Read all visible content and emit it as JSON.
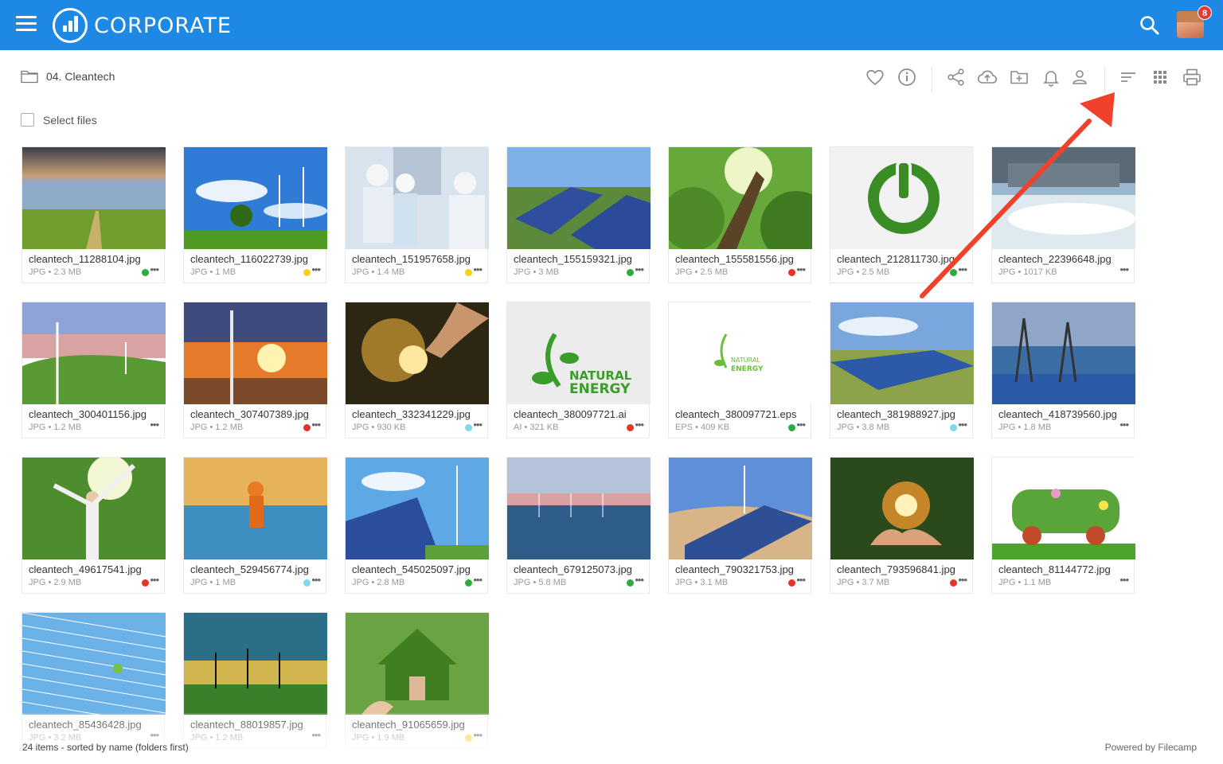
{
  "header": {
    "brand": "CORPORATE",
    "notification_count": "8"
  },
  "breadcrumb": {
    "folder": "04. Cleantech"
  },
  "toolbar": {
    "icons": [
      "heart-icon",
      "info-icon",
      "share-icon",
      "cloud-upload-icon",
      "new-folder-icon",
      "bell-icon",
      "user-icon",
      "sort-icon",
      "grid-view-icon",
      "print-icon"
    ]
  },
  "select_files_label": "Select files",
  "status_colors": {
    "green": "#2eaa3e",
    "yellow": "#f7d11e",
    "red": "#e53527",
    "cyan": "#7fd8ee"
  },
  "files": [
    {
      "name": "cleantech_11288104.jpg",
      "meta": "JPG • 2.3 MB",
      "status": "green"
    },
    {
      "name": "cleantech_116022739.jpg",
      "meta": "JPG • 1 MB",
      "status": "yellow"
    },
    {
      "name": "cleantech_151957658.jpg",
      "meta": "JPG • 1.4 MB",
      "status": "yellow"
    },
    {
      "name": "cleantech_155159321.jpg",
      "meta": "JPG • 3 MB",
      "status": "green"
    },
    {
      "name": "cleantech_155581556.jpg",
      "meta": "JPG • 2.5 MB",
      "status": "red"
    },
    {
      "name": "cleantech_212811730.jpg",
      "meta": "JPG • 2.5 MB",
      "status": "green"
    },
    {
      "name": "cleantech_22396648.jpg",
      "meta": "JPG • 1017 KB",
      "status": ""
    },
    {
      "name": "cleantech_300401156.jpg",
      "meta": "JPG • 1.2 MB",
      "status": ""
    },
    {
      "name": "cleantech_307407389.jpg",
      "meta": "JPG • 1.2 MB",
      "status": "red"
    },
    {
      "name": "cleantech_332341229.jpg",
      "meta": "JPG • 930 KB",
      "status": "cyan"
    },
    {
      "name": "cleantech_380097721.ai",
      "meta": "AI • 321 KB",
      "status": "red"
    },
    {
      "name": "cleantech_380097721.eps",
      "meta": "EPS • 409 KB",
      "status": "green"
    },
    {
      "name": "cleantech_381988927.jpg",
      "meta": "JPG • 3.8 MB",
      "status": "cyan"
    },
    {
      "name": "cleantech_418739560.jpg",
      "meta": "JPG • 1.8 MB",
      "status": ""
    },
    {
      "name": "cleantech_49617541.jpg",
      "meta": "JPG • 2.9 MB",
      "status": "red"
    },
    {
      "name": "cleantech_529456774.jpg",
      "meta": "JPG • 1 MB",
      "status": "cyan"
    },
    {
      "name": "cleantech_545025097.jpg",
      "meta": "JPG • 2.8 MB",
      "status": "green"
    },
    {
      "name": "cleantech_679125073.jpg",
      "meta": "JPG • 5.8 MB",
      "status": "green"
    },
    {
      "name": "cleantech_790321753.jpg",
      "meta": "JPG • 3.1 MB",
      "status": "red"
    },
    {
      "name": "cleantech_793596841.jpg",
      "meta": "JPG • 3.7 MB",
      "status": "red"
    },
    {
      "name": "cleantech_81144772.jpg",
      "meta": "JPG • 1.1 MB",
      "status": ""
    },
    {
      "name": "cleantech_85436428.jpg",
      "meta": "JPG • 3.2 MB",
      "status": ""
    },
    {
      "name": "cleantech_88019857.jpg",
      "meta": "JPG • 1.2 MB",
      "status": ""
    },
    {
      "name": "cleantech_91065659.jpg",
      "meta": "JPG • 1.9 MB",
      "status": "yellow"
    }
  ],
  "footer": {
    "status": "24 items - sorted by name (folders first)",
    "powered": "Powered by Filecamp"
  },
  "annotation_arrow_color": "#f0412a"
}
